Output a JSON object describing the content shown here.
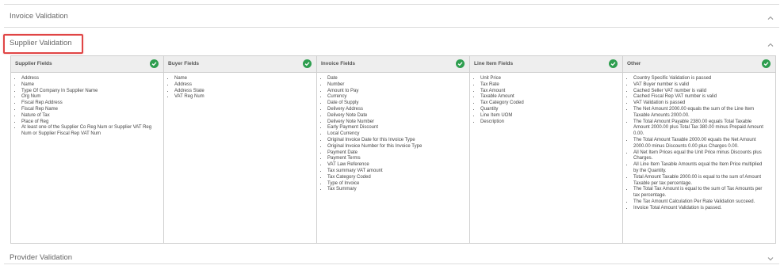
{
  "sections": {
    "invoice_validation": {
      "title": "Invoice Validation"
    },
    "supplier_validation": {
      "title": "Supplier Validation"
    },
    "provider_validation": {
      "title": "Provider Validation"
    }
  },
  "columns": [
    {
      "title": "Supplier Fields",
      "items": [
        "Address",
        "Name",
        "Type Of Company In Supplier Name",
        "Org Num",
        "Fiscal Rep Address",
        "Fiscal Rep Name",
        "Nature of Tax",
        "Place of Reg",
        "At least one of the Supplier Co Reg Num or Supplier VAT Reg Num or Supplier Fiscal Rep VAT Num"
      ]
    },
    {
      "title": "Buyer Fields",
      "items": [
        "Name",
        "Address",
        "Address State",
        "VAT Reg Num"
      ]
    },
    {
      "title": "Invoice Fields",
      "items": [
        "Date",
        "Number",
        "Amount to Pay",
        "Currency",
        "Date of Supply",
        "Delivery Address",
        "Delivery Note Date",
        "Delivery Note Number",
        "Early Payment Discount",
        "Local Currency",
        "Original Invoice Date for this Invoice Type",
        "Original Invoice Number for this Invoice Type",
        "Payment Date",
        "Payment Terms",
        "VAT Law Reference",
        "Tax summary VAT amount",
        "Tax Category Coded",
        "Type of Invoice",
        "Tax Summary"
      ]
    },
    {
      "title": "Line Item Fields",
      "items": [
        "Unit Price",
        "Tax Rate",
        "Tax Amount",
        "Taxable Amount",
        "Tax Category Coded",
        "Quantity",
        "Line Item UOM",
        "Description"
      ]
    },
    {
      "title": "Other",
      "items": [
        "Country Specific Validation is passed",
        "VAT Buyer number is valid",
        "Cached Seller VAT number is valid",
        "Cached Fiscal Rep VAT number is valid",
        "VAT Validation is passed",
        "The Net Amount 2000.00 equals the sum of the Line Item Taxable Amounts 2000.00.",
        "The Total Amount Payable 2380.00 equals Total Taxable Amount 2000.00 plus Total Tax 380.00 minus Prepaid Amount 0.00.",
        "The Total Amount Taxable 2000.00 equals the Net Amount 2000.00 minus Discounts 0.00 plus Charges 0.00.",
        "All Net Item Prices equal the Unit Price minus Discounts plus Charges.",
        "All Line Item Taxable Amounts equal the Item Price multiplied by the Quantity.",
        "Total Amount Taxable 2000.00 is equal to the sum of Amount Taxable per tax percentage.",
        "The Total Tax Amount is equal to the sum of Tax Amounts per tax percentage.",
        "The Tax Amount Calculation Per Rate Validation succeed.",
        "Invoice Total Amount Validation is passed."
      ]
    }
  ],
  "colors": {
    "check": "#2e9e4f",
    "highlight": "#e04545",
    "header_bg": "#eeeeee"
  }
}
